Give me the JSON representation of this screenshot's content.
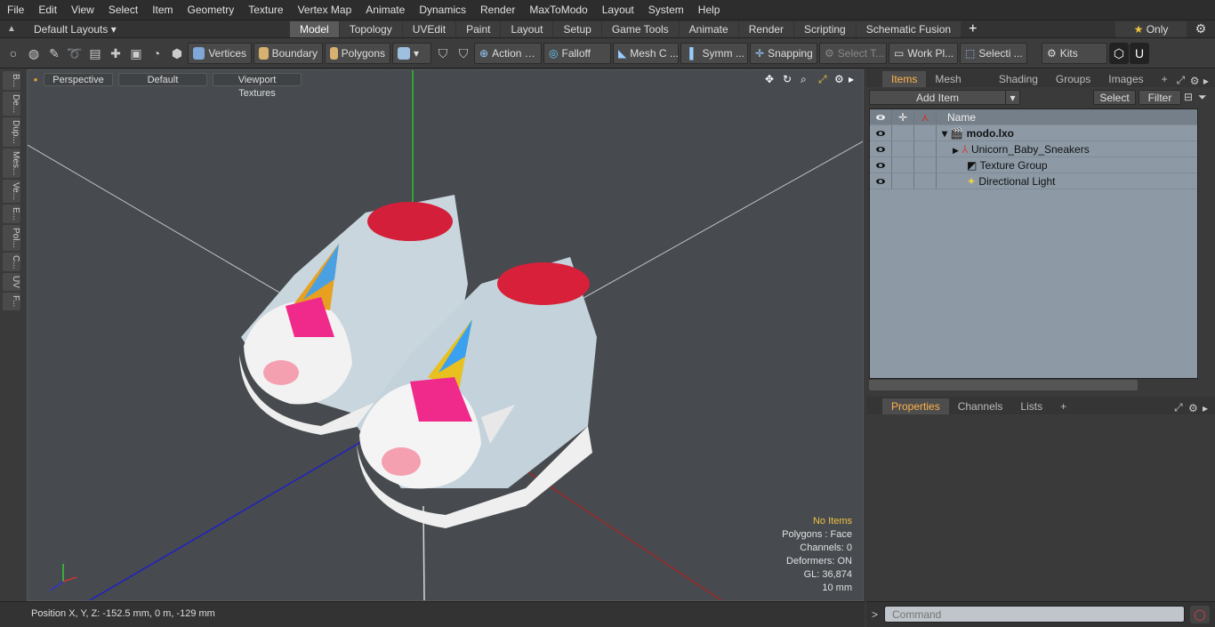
{
  "menu": [
    "File",
    "Edit",
    "View",
    "Select",
    "Item",
    "Geometry",
    "Texture",
    "Vertex Map",
    "Animate",
    "Dynamics",
    "Render",
    "MaxToModo",
    "Layout",
    "System",
    "Help"
  ],
  "layout": {
    "dropdown": "Default Layouts",
    "tabs": [
      "Model",
      "Topology",
      "UVEdit",
      "Paint",
      "Layout",
      "Setup",
      "Game Tools",
      "Animate",
      "Render",
      "Scripting",
      "Schematic Fusion"
    ],
    "only": "Only"
  },
  "toolbar": {
    "vertices": "Vertices",
    "boundary": "Boundary",
    "polygons": "Polygons",
    "action": "Action",
    "falloff": "Falloff",
    "mesh": "Mesh C ...",
    "symm": "Symm ...",
    "snapping": "Snapping",
    "select_t": "Select T...",
    "work": "Work Pl...",
    "selecti": "Selecti ...",
    "kits": "Kits"
  },
  "lefttabs": [
    "B...",
    "De...",
    "Dup...",
    "Mes...",
    "Ve...",
    "E...",
    "Pol...",
    "C...",
    "UV",
    "F..."
  ],
  "viewport": {
    "view": "Perspective",
    "shading": "Default",
    "textures": "Viewport Textures",
    "info": {
      "items": "No Items",
      "polygons": "Polygons : Face",
      "channels": "Channels: 0",
      "deformers": "Deformers: ON",
      "gl": "GL: 36,874",
      "scale": "10 mm"
    }
  },
  "status": {
    "position": "Position X, Y, Z:   -152.5 mm, 0 m, -129 mm"
  },
  "items_panel": {
    "tabs": [
      "Items",
      "Mesh Ops",
      "Shading",
      "Groups",
      "Images"
    ],
    "add_item": "Add Item",
    "select": "Select",
    "filter": "Filter",
    "name_col": "Name",
    "rows": [
      "modo.lxo",
      "Unicorn_Baby_Sneakers",
      "Texture Group",
      "Directional Light"
    ]
  },
  "props_panel": {
    "tabs": [
      "Properties",
      "Channels",
      "Lists"
    ]
  },
  "command": {
    "placeholder": "Command"
  }
}
